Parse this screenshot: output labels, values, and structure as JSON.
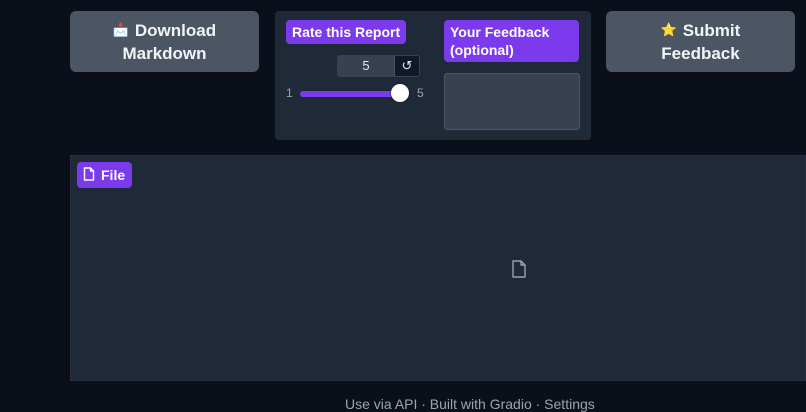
{
  "actions": {
    "download": {
      "icon": "📩",
      "line1": "Download",
      "line2": "Markdown"
    },
    "submit": {
      "icon": "⭐",
      "line1": "Submit",
      "line2": "Feedback"
    }
  },
  "rating": {
    "label": "Rate this Report",
    "value": "5",
    "reset_icon": "↺",
    "min": "1",
    "max": "5",
    "slider_level": 1.0
  },
  "feedback": {
    "label": "Your Feedback (optional)",
    "value": ""
  },
  "file": {
    "label": "File"
  },
  "footer": {
    "text": "Use via API  ·  Built with Gradio  ·  Settings"
  },
  "colors": {
    "background": "#0b0f19",
    "panel": "#1f2937",
    "accent": "#7c3aed",
    "button": "#4b5563"
  }
}
